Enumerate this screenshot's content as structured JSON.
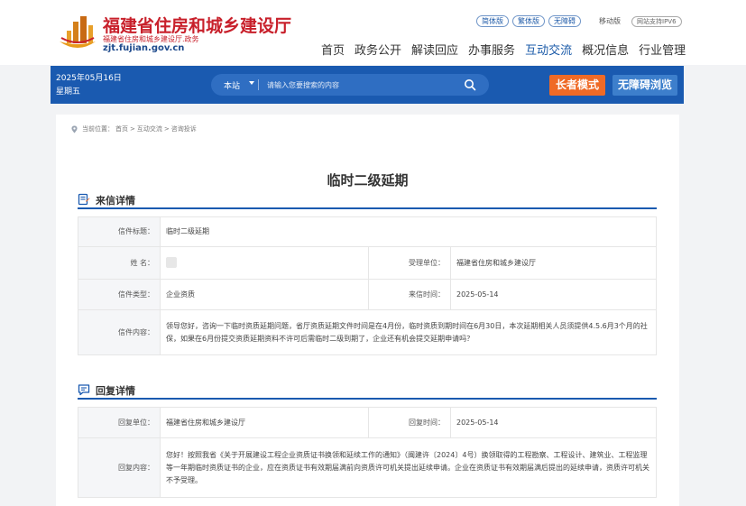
{
  "header": {
    "site_title": "福建省住房和城乡建设厅",
    "site_subtitle": "福建省住房和城乡建设厅.政务",
    "site_url": "zjt.fujian.gov.cn",
    "top_links": [
      "简体版",
      "繁体版",
      "无障碍"
    ],
    "mobile_label": "移动版",
    "ipv6_label": "网站支持IPV6",
    "nav": [
      "首页",
      "政务公开",
      "解读回应",
      "办事服务",
      "互动交流",
      "概况信息",
      "行业管理"
    ],
    "nav_active": "互动交流"
  },
  "bar": {
    "date": "2025年05月16日",
    "weekday": "星期五",
    "search_scope": "本站",
    "search_placeholder": "请输入您要搜索的内容",
    "elder_mode": "长者模式",
    "accessible": "无障碍浏览"
  },
  "breadcrumb": [
    "当前位置：",
    "首页",
    ">",
    "互动交流",
    ">",
    "咨询投诉"
  ],
  "page_title": "临时二级延期",
  "letter": {
    "section_title": "来信详情",
    "title_label": "信件标题：",
    "title_value": "临时二级延期",
    "name_label": "姓    名：",
    "org_label": "受理单位：",
    "org_value": "福建省住房和城乡建设厅",
    "type_label": "信件类型：",
    "type_value": "企业资质",
    "time_label": "来信时间：",
    "time_value": "2025-05-14",
    "content_label": "信件内容：",
    "content_value": "领导您好，咨询一下临时资质延期问题，省厅资质延期文件时间是在4月份，临时资质到期时间在6月30日，本次延期相关人员须提供4.5.6月3个月的社保，如果在6月份提交资质延期资料不许可后需临时二级到期了，企业还有机会提交延期申请吗？"
  },
  "reply": {
    "section_title": "回复详情",
    "unit_label": "回复单位：",
    "unit_value": "福建省住房和城乡建设厅",
    "time_label": "回复时间：",
    "time_value": "2025-05-14",
    "content_label": "回复内容：",
    "content_value": "您好！按照我省《关于开展建设工程企业资质证书换领和延续工作的通知》（闽建许〔2024〕4号）换领取得的工程勘察、工程设计、建筑业、工程监理等一年期临时资质证书的企业，应在资质证书有效期届满前向资质许可机关提出延续申请。企业在资质证书有效期届满后提出的延续申请，资质许可机关不予受理。"
  },
  "colors": {
    "brand_red": "#c8202b",
    "brand_blue": "#1a5ab0",
    "elder_orange": "#ef6a26"
  }
}
